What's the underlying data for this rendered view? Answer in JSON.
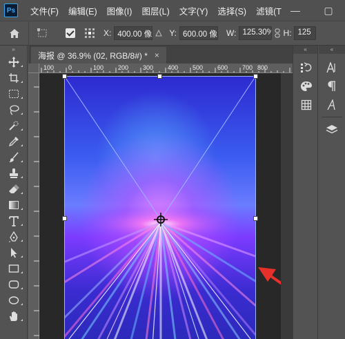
{
  "app": {
    "logo_text": "Ps"
  },
  "menu": {
    "items": [
      "文件(F)",
      "编辑(E)",
      "图像(I)",
      "图层(L)",
      "文字(Y)",
      "选择(S)",
      "滤镜(T"
    ]
  },
  "window_controls": {
    "minimize": "—",
    "maximize": "▢"
  },
  "options_bar": {
    "x_label": "X:",
    "x_value": "400.00 像",
    "y_label": "Y:",
    "y_value": "600.00 像",
    "w_label": "W:",
    "w_value": "125.30%",
    "h_label": "H:",
    "h_value": "125"
  },
  "document_tab": {
    "title": "海报 @ 36.9% (02, RGB/8#) *",
    "close": "×"
  },
  "ruler": {
    "labels": [
      "100",
      "0",
      "100",
      "200",
      "300",
      "400",
      "500",
      "600",
      "700",
      "800"
    ]
  },
  "colors": {
    "menubar_bg": "#505050",
    "panel_bg": "#535353",
    "canvas_bg": "#282828",
    "accent_arrow": "#e8302a"
  },
  "icons": {
    "home": "home-icon",
    "transform_reference": "reference-point-icon",
    "move": "move-icon",
    "artboard": "artboard-icon",
    "marquee": "rect-marquee-icon",
    "lasso": "lasso-icon",
    "quick_select": "quick-select-icon",
    "eyedropper": "eyedropper-icon",
    "brush": "brush-icon",
    "stamp": "clone-stamp-icon",
    "eraser": "eraser-icon",
    "gradient": "gradient-icon",
    "type": "type-icon",
    "pen": "pen-icon",
    "path_select": "path-select-icon",
    "rectangle": "rectangle-icon",
    "rounded_rect": "rounded-rect-icon",
    "ellipse": "ellipse-icon",
    "hand": "hand-icon"
  }
}
